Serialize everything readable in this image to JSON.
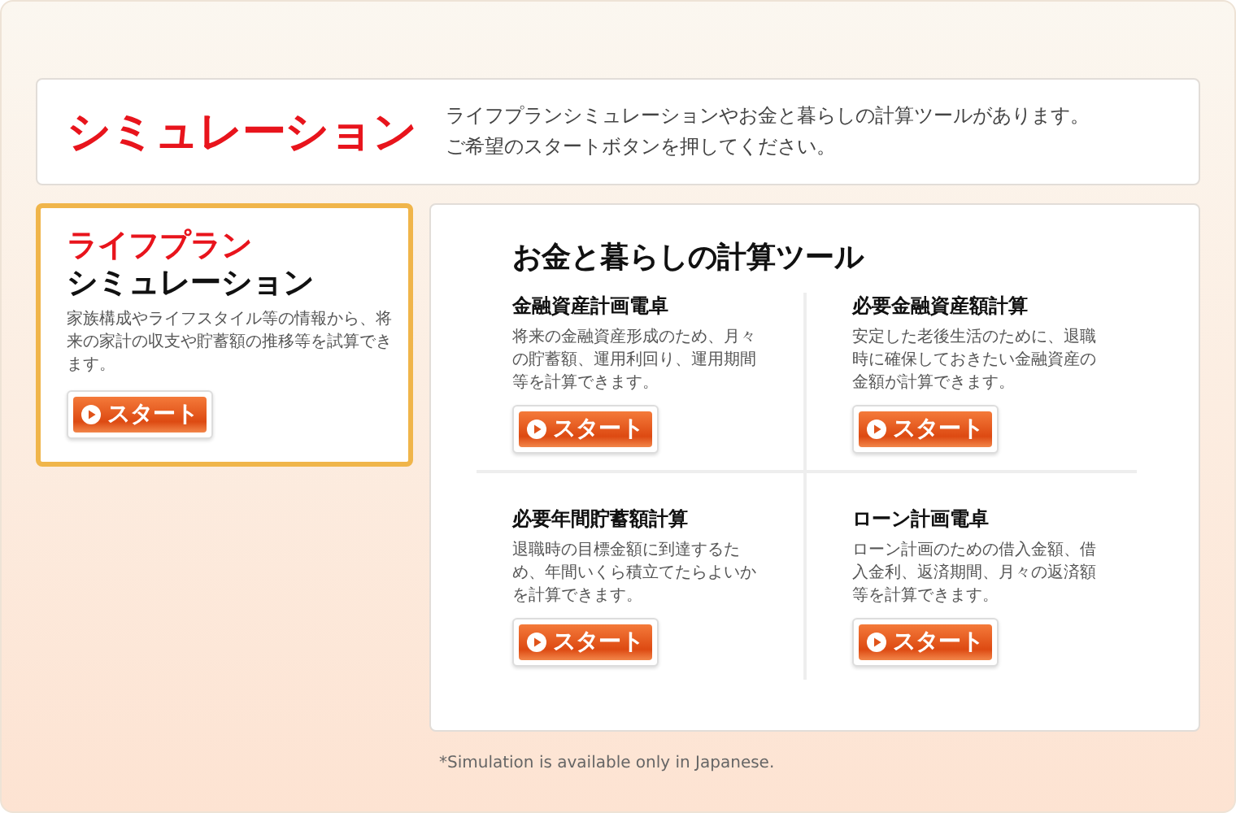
{
  "header": {
    "title": "シミュレーション",
    "description": [
      "ライフプランシミュレーションやお金と暮らしの計算ツールがあります。",
      "ご希望のスタートボタンを押してください。"
    ]
  },
  "lifeplan": {
    "title_accent": "ライフプラン",
    "title": "シミュレーション",
    "description": "家族構成やライフスタイル等の情報から、将来の家計の収支や貯蓄額の推移等を試算できます。",
    "button": "スタート"
  },
  "tools": {
    "title": "お金と暮らしの計算ツール",
    "items": [
      {
        "name": "金融資産計画電卓",
        "description": "将来の金融資産形成のため、月々の貯蓄額、運用利回り、運用期間等を計算できます。",
        "button": "スタート"
      },
      {
        "name": "必要金融資産額計算",
        "description": "安定した老後生活のために、退職時に確保しておきたい金融資産の金額が計算できます。",
        "button": "スタート"
      },
      {
        "name": "必要年間貯蓄額計算",
        "description": "退職時の目標金額に到達するため、年間いくら積立てたらよいかを計算できます。",
        "button": "スタート"
      },
      {
        "name": "ローン計画電卓",
        "description": "ローン計画のための借入金額、借入金利、返済期間、月々の返済額等を計算できます。",
        "button": "スタート"
      }
    ]
  },
  "footnote": "*Simulation is available only in Japanese."
}
